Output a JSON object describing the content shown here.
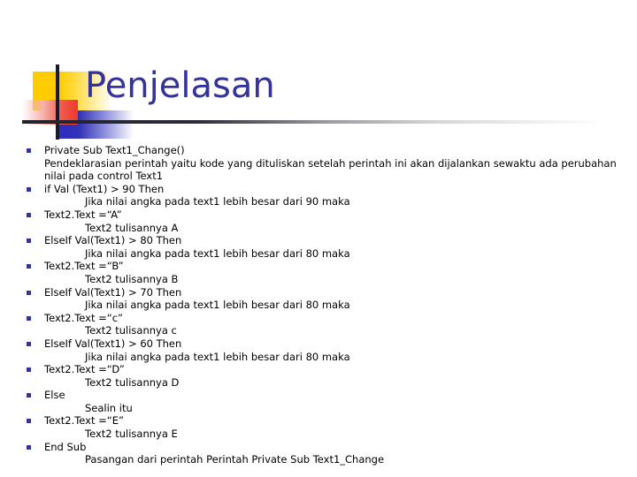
{
  "slide": {
    "title": "Penjelasan",
    "title_color": "#333399",
    "bullet_color": "#333399",
    "body_color": "#000000",
    "background_color": "#FFFFFF",
    "decoration": {
      "yellow_color": "#FFCC00",
      "blue_color": "#3333B8",
      "red_color": "#F0392B",
      "rule_color": "#22222E"
    },
    "body_lines": [
      {
        "level": 1,
        "bullet": true,
        "text": "Private Sub Text1_Change()"
      },
      {
        "level": 1,
        "bullet": false,
        "text": "Pendeklarasian perintah yaitu kode yang dituliskan setelah perintah ini akan dijalankan sewaktu ada perubahan nilai pada control Text1"
      },
      {
        "level": 1,
        "bullet": true,
        "text": "if Val (Text1) > 90 Then"
      },
      {
        "level": 2,
        "bullet": false,
        "text": "Jika nilai angka pada text1 lebih besar dari 90 maka"
      },
      {
        "level": 1,
        "bullet": true,
        "text": "Text2.Text =“A”"
      },
      {
        "level": 2,
        "bullet": false,
        "text": "Text2 tulisannya A"
      },
      {
        "level": 1,
        "bullet": true,
        "text": "ElseIf Val(Text1) > 80 Then"
      },
      {
        "level": 2,
        "bullet": false,
        "text": "Jika nilai angka pada text1 lebih besar dari 80 maka"
      },
      {
        "level": 1,
        "bullet": true,
        "text": "Text2.Text =“B”"
      },
      {
        "level": 2,
        "bullet": false,
        "text": "Text2 tulisannya B"
      },
      {
        "level": 1,
        "bullet": true,
        "text": "ElseIf Val(Text1) > 70 Then"
      },
      {
        "level": 2,
        "bullet": false,
        "text": "Jika nilai angka pada text1 lebih besar dari 80 maka"
      },
      {
        "level": 1,
        "bullet": true,
        "text": "Text2.Text =“c”"
      },
      {
        "level": 2,
        "bullet": false,
        "text": "Text2 tulisannya c"
      },
      {
        "level": 1,
        "bullet": true,
        "text": "ElseIf Val(Text1) > 60 Then"
      },
      {
        "level": 2,
        "bullet": false,
        "text": "Jika nilai angka pada text1 lebih besar dari 80 maka"
      },
      {
        "level": 1,
        "bullet": true,
        "text": "Text2.Text =“D”"
      },
      {
        "level": 2,
        "bullet": false,
        "text": "Text2 tulisannya D"
      },
      {
        "level": 1,
        "bullet": true,
        "text": "Else"
      },
      {
        "level": 2,
        "bullet": false,
        "text": "Sealin itu"
      },
      {
        "level": 1,
        "bullet": true,
        "text": "Text2.Text =“E”"
      },
      {
        "level": 2,
        "bullet": false,
        "text": "Text2 tulisannya E"
      },
      {
        "level": 1,
        "bullet": true,
        "text": "End Sub"
      },
      {
        "level": 2,
        "bullet": false,
        "text": "Pasangan dari perintah Perintah Private Sub Text1_Change"
      }
    ]
  }
}
